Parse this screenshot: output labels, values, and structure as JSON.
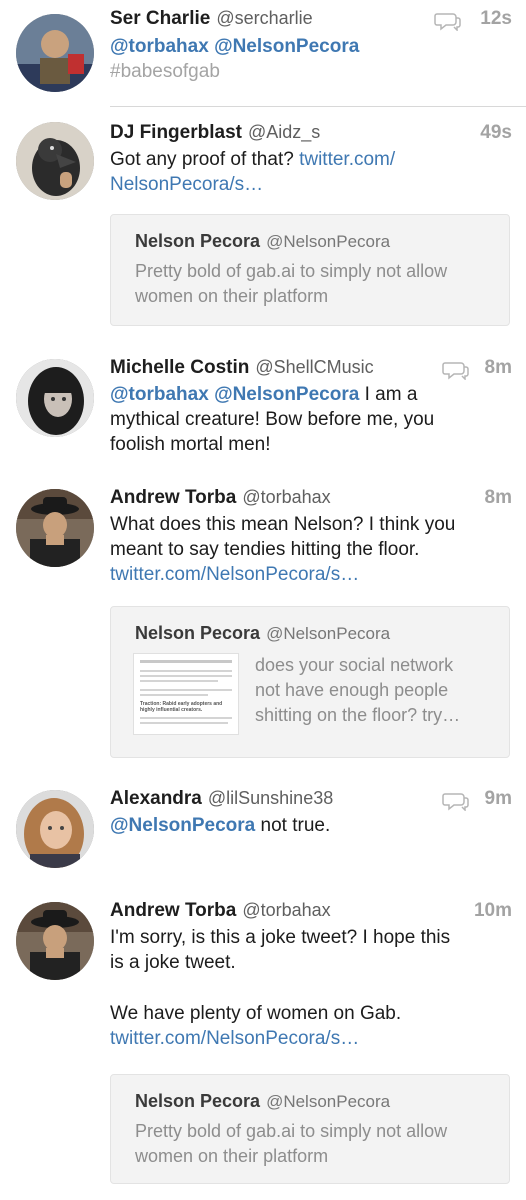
{
  "tweets": [
    {
      "name": "Ser Charlie",
      "handle": "@sercharlie",
      "time": "12s",
      "line1": [
        "@torbahax",
        "@NelsonPecora"
      ],
      "hashtag": "#babesofgab"
    },
    {
      "name": "DJ Fingerblast",
      "handle": "@Aidz_s",
      "time": "49s",
      "text": "Got any proof of that?",
      "link1": "twitter.com/",
      "link2": "NelsonPecora/s…",
      "quote": {
        "name": "Nelson Pecora",
        "handle": "@NelsonPecora",
        "line1": "Pretty bold of gab.ai to simply not allow",
        "line2": "women on their platform"
      }
    },
    {
      "name": "Michelle Costin",
      "handle": "@ShellCMusic",
      "time": "8m",
      "mentions": [
        "@torbahax",
        "@NelsonPecora"
      ],
      "text1": "I am a",
      "text2": "mythical creature! Bow before me, you",
      "text3": "foolish mortal men!"
    },
    {
      "name": "Andrew Torba",
      "handle": "@torbahax",
      "time": "8m",
      "line1": "What does this mean Nelson? I think you",
      "line2": "meant to say tendies hitting the floor.",
      "link": "twitter.com/NelsonPecora/s…",
      "quote": {
        "name": "Nelson Pecora",
        "handle": "@NelsonPecora",
        "line1": "does your social network",
        "line2": "not have enough people",
        "line3": "shitting on the floor? try…",
        "thumb_heading": "Traction: Rabid early adopters and highly influential creators."
      }
    },
    {
      "name": "Alexandra",
      "handle": "@lilSunshine38",
      "time": "9m",
      "mention": "@NelsonPecora",
      "text": "not true."
    },
    {
      "name": "Andrew Torba",
      "handle": "@torbahax",
      "time": "10m",
      "line1": "I'm sorry, is this a joke tweet? I hope this",
      "line2": "is a joke tweet.",
      "line3": "We have plenty of women on Gab.",
      "link": "twitter.com/NelsonPecora/s…",
      "quote": {
        "name": "Nelson Pecora",
        "handle": "@NelsonPecora",
        "line1": "Pretty bold of gab.ai to simply not allow",
        "line2": "women on their platform"
      }
    }
  ],
  "colors": {
    "link": "#3f78b2",
    "time": "#a3a3a3",
    "quote_bg": "#f3f3f3"
  }
}
